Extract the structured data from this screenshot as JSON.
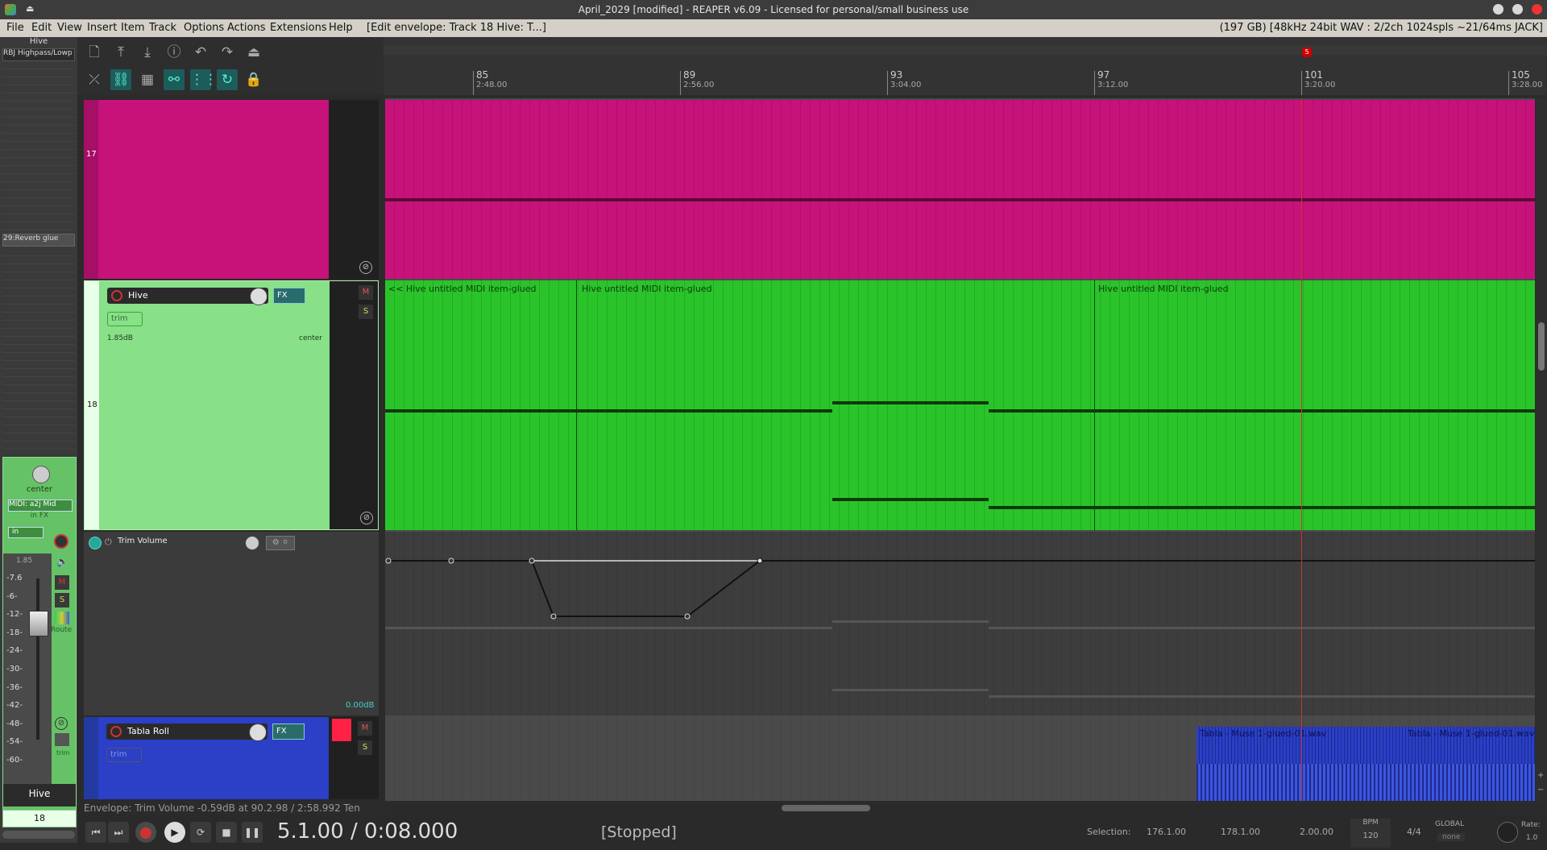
{
  "window": {
    "title": "April_2029 [modified] - REAPER v6.09 - Licensed for personal/small business use"
  },
  "menu": {
    "items": [
      "File",
      "Edit",
      "View",
      "Insert",
      "Item",
      "Track",
      "Options",
      "Actions",
      "Extensions",
      "Help"
    ],
    "context": "[Edit envelope: Track 18 Hive: T...]",
    "status": "(197 GB) [48kHz 24bit WAV : 2/2ch 1024spls ~21/64ms JACK]"
  },
  "mixer": {
    "top_label": "Hive",
    "fx_slot": "RBJ Highpass/Lowp",
    "reverb_send": "29:Reverb glue",
    "fx_label": "FX",
    "pan_label": "center",
    "midi_input": "MIDI: a2j Mid",
    "in_fx": "in FX",
    "in_label": "in",
    "volume": "1.85",
    "db_scale": [
      "-7.6",
      "-6-",
      "-12-",
      "-18-",
      "-24-",
      "-30-",
      "-36-",
      "-42-",
      "-48-",
      "-54-",
      "-60-"
    ],
    "m": "M",
    "s": "S",
    "route": "Route",
    "trim": "trim",
    "track_name": "Hive",
    "track_number": "18"
  },
  "ruler": {
    "marker": "5",
    "bars": [
      {
        "bar": "85",
        "time": "2:48.00"
      },
      {
        "bar": "89",
        "time": "2:56.00"
      },
      {
        "bar": "93",
        "time": "3:04.00"
      },
      {
        "bar": "97",
        "time": "3:12.00"
      },
      {
        "bar": "101",
        "time": "3:20.00"
      },
      {
        "bar": "105",
        "time": "3:28.00"
      }
    ]
  },
  "tracks": {
    "t17": {
      "number": "17",
      "color": "#c7127a"
    },
    "t18": {
      "number": "18",
      "name": "Hive",
      "fx": "FX",
      "trim": "trim",
      "volume": "1.85dB",
      "pan": "center",
      "m": "M",
      "s": "S",
      "color": "#27c227",
      "items": [
        "<< Hive untitled MIDI item-glued",
        "Hive untitled MIDI item-glued",
        "Hive untitled MIDI item-glued"
      ]
    },
    "envelope": {
      "name": "Trim Volume",
      "value": "0.00dB"
    },
    "tabla": {
      "name": "Tabla Roll",
      "fx": "FX",
      "trim": "trim",
      "m": "M",
      "s": "S",
      "color": "#2b3fc7",
      "items": [
        "Tabla - Muse 1-glued-01.wav",
        "Tabla - Muse 1-glued-01.wav"
      ]
    }
  },
  "status_line": "Envelope: Trim Volume -0.59dB at 90.2.98 / 2:58.992 Ten",
  "transport": {
    "position": "5.1.00 / 0:08.000",
    "state": "[Stopped]",
    "selection_label": "Selection:",
    "sel_start": "176.1.00",
    "sel_end": "178.1.00",
    "sel_len": "2.00.00",
    "bpm_label": "BPM",
    "bpm": "120",
    "timesig": "4/4",
    "global": "GLOBAL",
    "none": "none",
    "rate_label": "Rate:",
    "rate": "1.0"
  }
}
